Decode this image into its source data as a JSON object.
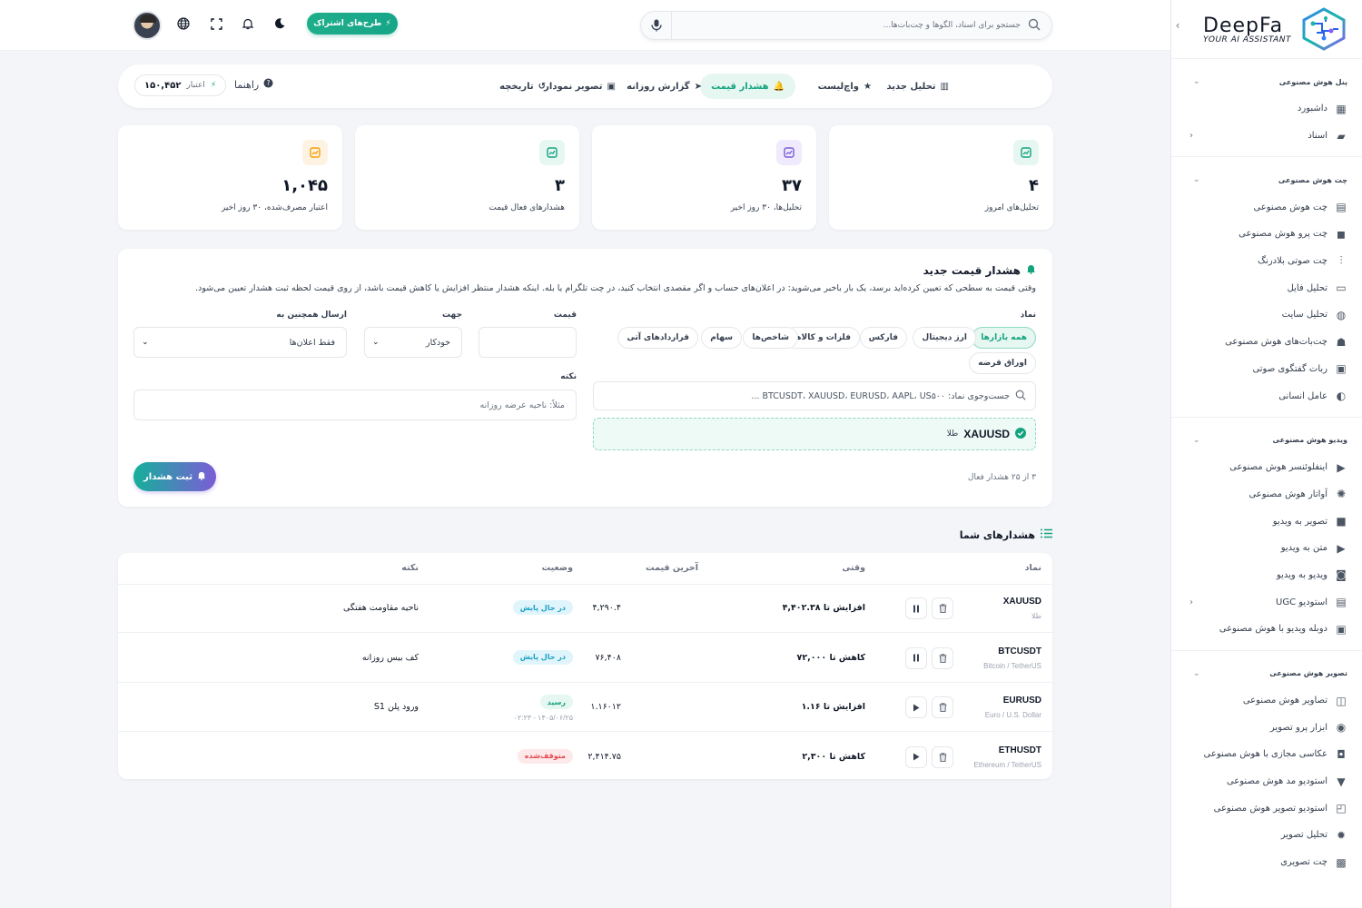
{
  "brand": {
    "name": "DeepFa",
    "tagline": "YOUR AI ASSISTANT"
  },
  "topbar": {
    "search_placeholder": "جستجو برای اسناد، الگوها و چت‌بات‌ها...",
    "plans_label": "طرح‌های اشتراک"
  },
  "sidebar": {
    "sections": [
      {
        "title": "پنل هوش مصنوعی",
        "items": [
          {
            "label": "داشبورد",
            "icon": "dashboard-icon"
          },
          {
            "label": "اسناد",
            "icon": "folder-icon",
            "has_children": true
          }
        ]
      },
      {
        "title": "چت هوش مصنوعی",
        "items": [
          {
            "label": "چت هوش مصنوعی",
            "icon": "chat-icon"
          },
          {
            "label": "چت پرو هوش مصنوعی",
            "icon": "chats-icon"
          },
          {
            "label": "چت صوتی بلادرنگ",
            "icon": "waveform-icon"
          },
          {
            "label": "تحلیل فایل",
            "icon": "file-icon"
          },
          {
            "label": "تحلیل سایت",
            "icon": "globe-icon"
          },
          {
            "label": "چت‌بات‌های هوش مصنوعی",
            "icon": "robot-icon"
          },
          {
            "label": "ربات گفتگوی صوتی",
            "icon": "voice-bot-icon"
          },
          {
            "label": "عامل انسانی",
            "icon": "headset-icon"
          }
        ]
      },
      {
        "title": "ویدیو هوش مصنوعی",
        "items": [
          {
            "label": "اینفلوئنسر هوش مصنوعی",
            "icon": "video-camera-icon"
          },
          {
            "label": "آواتار هوش مصنوعی",
            "icon": "avatar-icon"
          },
          {
            "label": "تصویر به ویدیو",
            "icon": "video-icon"
          },
          {
            "label": "متن به ویدیو",
            "icon": "video-text-icon"
          },
          {
            "label": "ویدیو به ویدیو",
            "icon": "video-swap-icon"
          },
          {
            "label": "استودیو UGC",
            "icon": "clapper-icon",
            "has_children": true
          },
          {
            "label": "دوبله ویدیو با هوش مصنوعی",
            "icon": "dub-icon"
          }
        ]
      },
      {
        "title": "تصویر هوش مصنوعی",
        "items": [
          {
            "label": "تصاویر هوش مصنوعی",
            "icon": "image-scan-icon"
          },
          {
            "label": "ابزار پرو تصویر",
            "icon": "palette-icon"
          },
          {
            "label": "عکاسی مجازی با هوش مصنوعی",
            "icon": "camera-icon"
          },
          {
            "label": "استودیو مد هوش مصنوعی",
            "icon": "shirt-icon"
          },
          {
            "label": "استودیو تصویر هوش مصنوعی",
            "icon": "gallery-icon"
          },
          {
            "label": "تحلیل تصویر",
            "icon": "image-analyze-icon"
          },
          {
            "label": "چت تصویری",
            "icon": "image-chat-icon"
          }
        ]
      }
    ]
  },
  "tabs": {
    "items": [
      {
        "label": "تحلیل جدید",
        "icon": "chart-icon"
      },
      {
        "label": "واچ‌لیست",
        "icon": "star-icon"
      },
      {
        "label": "هشدار قیمت",
        "icon": "bell-icon",
        "active": true
      },
      {
        "label": "گزارش روزانه",
        "icon": "send-icon"
      },
      {
        "label": "تصویر نمودار",
        "icon": "image-icon"
      },
      {
        "label": "تاریخچه",
        "icon": "history-icon"
      }
    ],
    "help_label": "راهنما",
    "credit_label": "اعتبار",
    "credit_value": "۱۵۰,۴۵۲"
  },
  "stats": [
    {
      "value": "۴",
      "label": "تحلیل‌های امروز",
      "icon": "chart-line-icon",
      "color": "#14a37f",
      "bg": "#e6f6f1"
    },
    {
      "value": "۳۷",
      "label": "تحلیل‌ها، ۳۰ روز اخیر",
      "icon": "calendar-icon",
      "color": "#7c5cd6",
      "bg": "#efeafd"
    },
    {
      "value": "۳",
      "label": "هشدارهای فعال قیمت",
      "icon": "bell-icon",
      "color": "#14a37f",
      "bg": "#e6f6f1"
    },
    {
      "value": "۱,۰۴۵",
      "label": "اعتبار مصرف‌شده، ۳۰ روز اخیر",
      "icon": "coins-icon",
      "color": "#f59e0b",
      "bg": "#fef3e2"
    }
  ],
  "form": {
    "title": "هشدار قیمت جدید",
    "description": "وقتی قیمت به سطحی که تعیین کرده‌اید برسد، یک بار باخبر می‌شوید: در اعلان‌های حساب و اگر مقصدی انتخاب کنید، در چت تلگرام یا بله. اینکه هشدار منتظر افزایش یا کاهش قیمت باشد، از روی قیمت لحظه ثبت هشدار تعیین می‌شود.",
    "symbol_label": "نماد",
    "markets": [
      "همه بازارها",
      "ارز دیجیتال",
      "فارکس",
      "فلزات و کالاها",
      "شاخص‌ها",
      "سهام",
      "قراردادهای آتی",
      "اوراق قرضه"
    ],
    "symbol_search_placeholder": "جست‌وجوی نماد: BTCUSDT، XAUUSD، EURUSD، AAPL، US۵۰۰ ...",
    "selected_symbol": "XAUUSD",
    "selected_symbol_name": "طلا",
    "price_label": "قیمت",
    "price_value": "",
    "direction_label": "جهت",
    "direction_value": "خودکار",
    "send_label": "ارسال همچنین به",
    "send_value": "فقط اعلان‌ها",
    "note_label": "نکته",
    "note_placeholder": "مثلاً: ناحیه عرضه روزانه",
    "count_note": "۳ از ۲۵ هشدار فعال",
    "submit_label": "ثبت هشدار"
  },
  "alerts": {
    "title": "هشدارهای شما",
    "columns": [
      "نماد",
      "وقتی",
      "آخرین قیمت",
      "وضعیت",
      "نکته"
    ],
    "rows": [
      {
        "symbol": "XAUUSD",
        "name": "طلا",
        "when": "افزایش تا ۴,۴۰۲.۳۸",
        "last": "۴,۲۹۰.۴",
        "status": "در حال پایش",
        "status_type": "pending",
        "note": "ناحیه مقاومت هفتگی",
        "action": "pause"
      },
      {
        "symbol": "BTCUSDT",
        "name": "Bitcoin / TetherUS",
        "when": "کاهش تا ۷۲,۰۰۰",
        "last": "۷۶,۴۰۸",
        "status": "در حال پایش",
        "status_type": "pending",
        "note": "کف بیس روزانه",
        "action": "pause"
      },
      {
        "symbol": "EURUSD",
        "name": "Euro / U.S. Dollar",
        "when": "افزایش تا ۱.۱۶",
        "last": "۱.۱۶۰۱۲",
        "status": "رسید",
        "status_time": "۱۴۰۵/۰۶/۲۵ - ۰۲:۲۳",
        "status_type": "reached",
        "note": "ورود پلن S1",
        "action": "play"
      },
      {
        "symbol": "ETHUSDT",
        "name": "Ethereum / TetherUS",
        "when": "کاهش تا ۲,۳۰۰",
        "last": "۲,۴۱۴.۷۵",
        "status": "متوقف‌شده",
        "status_type": "stopped",
        "note": "",
        "action": "play"
      }
    ]
  }
}
